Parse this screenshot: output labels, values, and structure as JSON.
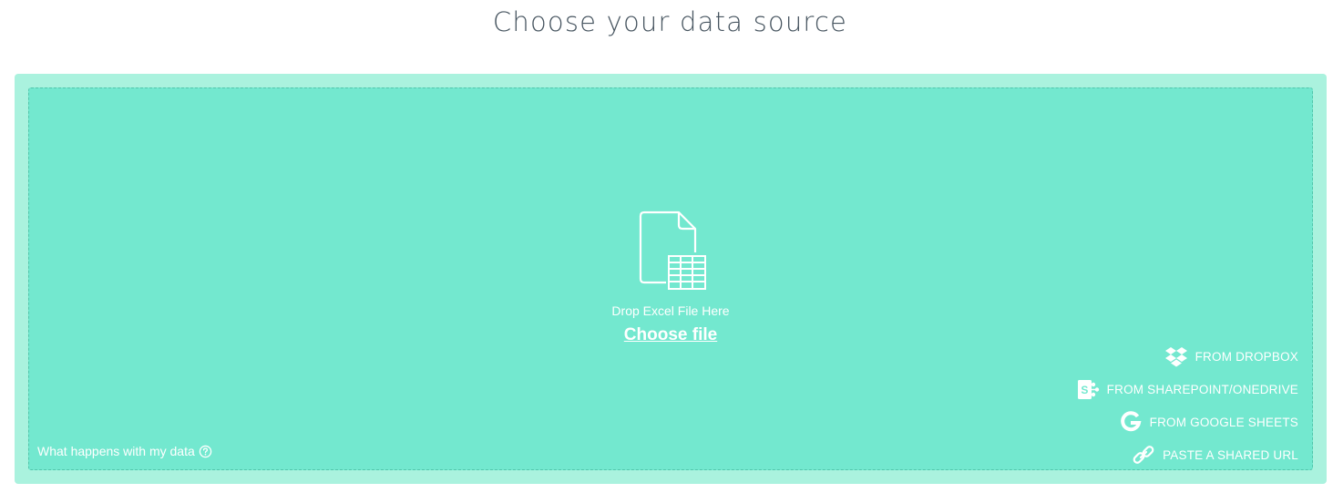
{
  "page": {
    "title": "Choose your data source"
  },
  "dropzone": {
    "drop_text": "Drop Excel File Here",
    "choose_label": "Choose file",
    "info_link": "What happens with my data",
    "file_icon": "excel-file-icon"
  },
  "sources": [
    {
      "label": "FROM DROPBOX",
      "icon": "dropbox-icon"
    },
    {
      "label": "FROM SHAREPOINT/ONEDRIVE",
      "icon": "sharepoint-icon"
    },
    {
      "label": "FROM GOOGLE SHEETS",
      "icon": "google-icon"
    },
    {
      "label": "PASTE A SHARED URL",
      "icon": "link-icon"
    }
  ],
  "colors": {
    "outer_panel": "#aaf2de",
    "drop_zone": "#73e8cf",
    "title": "#46545f",
    "text": "#ffffff"
  }
}
